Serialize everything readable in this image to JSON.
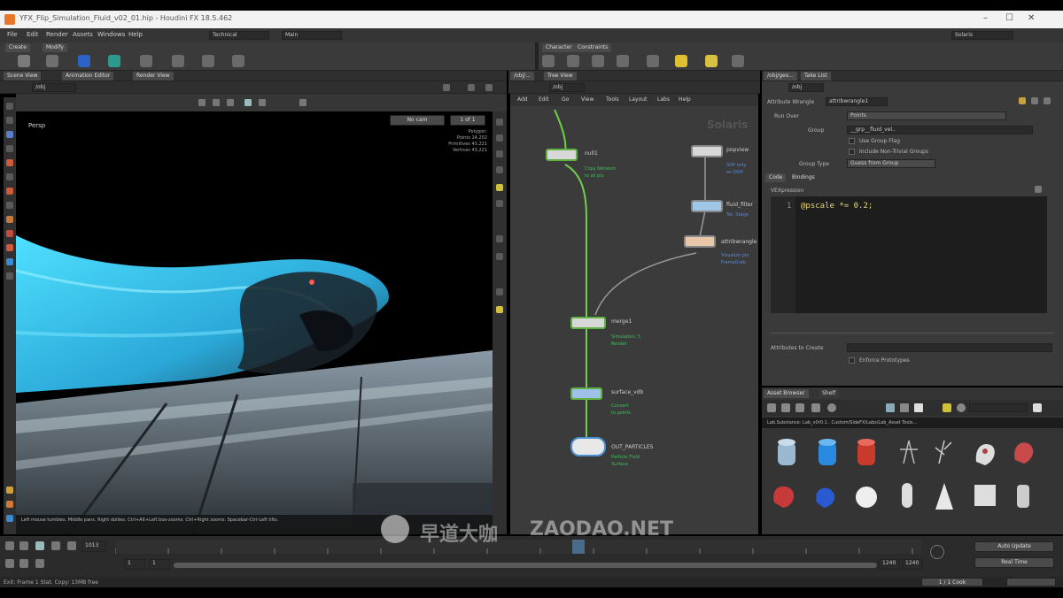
{
  "window": {
    "title": "YFX_Flip_Simulation_Fluid_v02_01.hip - Houdini FX 18.5.462",
    "controls": [
      "–",
      "☐",
      "✕"
    ]
  },
  "menubar": {
    "items": [
      "File",
      "Edit",
      "Render",
      "Assets",
      "Windows",
      "Help"
    ],
    "desktop": "Technical",
    "build": "Main",
    "right_label": "Solaris"
  },
  "shelf": {
    "tabs": [
      "Create",
      "Modify"
    ],
    "right_tabs": [
      "Character",
      "Constraints"
    ]
  },
  "viewer": {
    "tabs": [
      "Scene View",
      "Animation Editor",
      "Render View"
    ],
    "path": "/obj",
    "camera_label": "Persp",
    "cam_menu": "No cam",
    "stats": [
      "1 of 1",
      "Polygon:",
      "Points 14,202",
      "Primitives 43,221",
      "Vertices 43,221"
    ],
    "status_line": "Left mouse tumbles. Middle pans. Right dollies. Ctrl+Alt+Left box-zooms. Ctrl+Right zooms. Spacebar-Ctrl-Left tilts."
  },
  "network": {
    "tabs": [
      "/obj/...",
      "Tree View"
    ],
    "path": "/obj",
    "menus": [
      "Add",
      "Edit",
      "Go",
      "View",
      "Tools",
      "Layout",
      "Labs",
      "Help"
    ],
    "context_label": "Solaris",
    "nodes": [
      {
        "name": "null1",
        "sub1": "Copy Network",
        "sub2": "to all pts"
      },
      {
        "name": "popview",
        "sub1": "SOP only",
        "sub2": "on DOP"
      },
      {
        "name": "fluid_filter",
        "sub1": "Tet. Stage",
        "sub2": ""
      },
      {
        "name": "attribwrangle",
        "sub1": "Visualize pts",
        "sub2": "FrameGrab"
      },
      {
        "name": "merge1",
        "sub1": "Simulation: 5",
        "sub2": "Render"
      },
      {
        "name": "surface_vdb",
        "sub1": "Convert",
        "sub2": "to points"
      },
      {
        "name": "OUT_PARTICLES",
        "sub1": "Particle Fluid",
        "sub2": "Surface"
      }
    ]
  },
  "params": {
    "tabs": [
      "/obj/geo...",
      "Take List"
    ],
    "path": "/obj",
    "node_type": "Attribute Wrangle",
    "node_name": "attribwrangle1",
    "rows": [
      {
        "label": "Run Over",
        "value": "Points"
      },
      {
        "label": "Group",
        "value": "__grp__fluid_vel.."
      },
      {
        "label": "Group Type",
        "value": "Guess from Group"
      }
    ],
    "checks": [
      "Use Group Flag",
      "Include Non-Trivial Groups"
    ],
    "subtabs": [
      "Code",
      "Bindings"
    ],
    "section": "VEXpression",
    "code_line_no": "1",
    "code_text": "@pscale *= 0.2;",
    "bottom_label": "Attributes to Create",
    "bottom_check": "Enforce Prototypes"
  },
  "assets": {
    "tabs": [
      "Asset Browser",
      "Shelf"
    ],
    "path_text": "Lab.Substance: Lab_v0r0.1.. Custom/SideFX/Labs/Lab_Asset Tools...",
    "items": [
      "Asset",
      "Asset",
      "Asset",
      "Asset",
      "Asset",
      "Asset",
      "Asset",
      "Asset",
      "Asset",
      "Asset",
      "Asset",
      "Asset",
      "Asset",
      "Asset"
    ]
  },
  "timeline": {
    "frame": "1013",
    "start": "1",
    "start2": "1",
    "end": "1240",
    "end2": "1240",
    "buttons": [
      "Auto Update",
      "Real Time"
    ]
  },
  "statusbar": {
    "left": "Exit: Frame 1 Stat. Copy: 13MB free",
    "right": "1 / 1 Cook"
  },
  "watermark": {
    "cn": "早道大咖",
    "en": "ZAODAO.NET"
  },
  "colors": {
    "accent_green": "#5fb343",
    "fluid_cyan": "#3fd0f0",
    "panel_bg": "#3a3a3a"
  }
}
